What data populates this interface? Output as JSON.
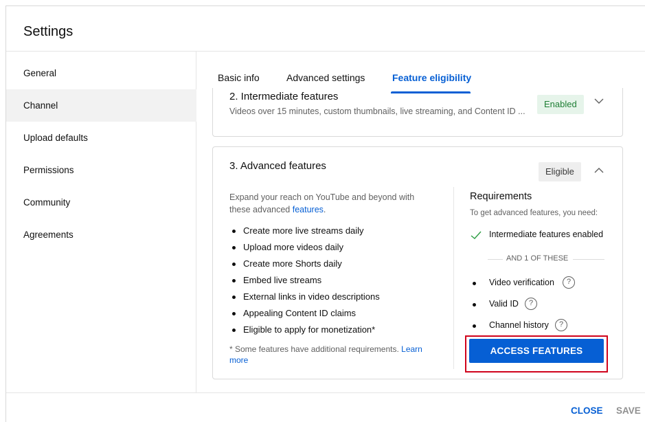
{
  "dialog": {
    "title": "Settings"
  },
  "sidebar": {
    "items": [
      {
        "label": "General"
      },
      {
        "label": "Channel"
      },
      {
        "label": "Upload defaults"
      },
      {
        "label": "Permissions"
      },
      {
        "label": "Community"
      },
      {
        "label": "Agreements"
      }
    ],
    "active": "Channel"
  },
  "tabs": {
    "items": [
      {
        "label": "Basic info"
      },
      {
        "label": "Advanced settings"
      },
      {
        "label": "Feature eligibility"
      }
    ],
    "active": "Feature eligibility"
  },
  "intermediate": {
    "title": "2. Intermediate features",
    "description": "Videos over 15 minutes, custom thumbnails, live streaming, and Content ID ...",
    "status": "Enabled",
    "chevron_icon": "chevron-down-icon"
  },
  "advanced": {
    "title": "3. Advanced features",
    "status": "Eligible",
    "chevron_icon": "chevron-up-icon",
    "intro_text": "Expand your reach on YouTube and beyond with these advanced ",
    "intro_link": "features",
    "intro_end": ".",
    "features": [
      "Create more live streams daily",
      "Upload more videos daily",
      "Create more Shorts daily",
      "Embed live streams",
      "External links in video descriptions",
      "Appealing Content ID claims",
      "Eligible to apply for monetization*"
    ],
    "footnote_text": "* Some features have additional requirements. ",
    "footnote_link": "Learn more",
    "requirements": {
      "title": "Requirements",
      "subtitle": "To get advanced features, you need:",
      "met": "Intermediate features enabled",
      "separator": "AND 1 OF THESE",
      "options": [
        "Video verification",
        "Valid ID",
        "Channel history"
      ],
      "help_glyph": "?"
    },
    "action_label": "ACCESS FEATURES"
  },
  "footer": {
    "close_label": "CLOSE",
    "save_label": "SAVE"
  },
  "colors": {
    "accent": "#065fd4",
    "enabled_bg": "#e6f4ea",
    "enabled_text": "#1e7e34",
    "highlight": "#d0021b"
  }
}
